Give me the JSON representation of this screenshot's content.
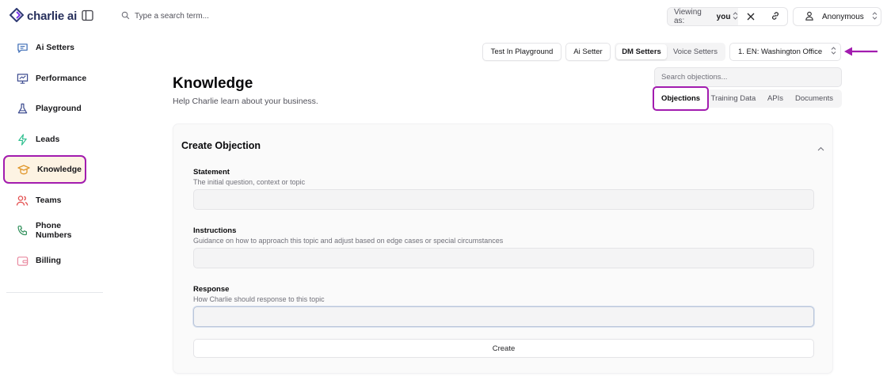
{
  "app": {
    "logo_text": "charlie ai",
    "brand_color": "#2f3a73",
    "accent_color": "#6d28d9",
    "annotation_color": "#a21caf"
  },
  "sidebar": {
    "items": [
      {
        "label": "Ai Setters",
        "icon": "chat-icon"
      },
      {
        "label": "Performance",
        "icon": "presentation-chart-icon"
      },
      {
        "label": "Playground",
        "icon": "flask-icon"
      },
      {
        "label": "Leads",
        "icon": "lightning-icon"
      },
      {
        "label": "Knowledge",
        "icon": "graduation-cap-icon",
        "active": true
      },
      {
        "label": "Teams",
        "icon": "users-icon"
      },
      {
        "label": "Phone Numbers",
        "icon": "phone-icon"
      },
      {
        "label": "Billing",
        "icon": "wallet-icon"
      }
    ]
  },
  "topbar": {
    "search_placeholder": "Type a search term...",
    "viewing_label": "Viewing as:",
    "viewing_value": "you",
    "user_name": "Anonymous"
  },
  "toolbar": {
    "test_playground": "Test In Playground",
    "ai_setter": "Ai Setter",
    "dm_setters": "DM Setters",
    "voice_setters": "Voice Setters",
    "office_select": "1. EN: Washington Office"
  },
  "page": {
    "title": "Knowledge",
    "subtitle": "Help Charlie learn about your business.",
    "search_placeholder": "Search objections...",
    "tabs": [
      "Objections",
      "Training Data",
      "APIs",
      "Documents"
    ],
    "active_tab": "Objections"
  },
  "form": {
    "title": "Create Objection",
    "fields": [
      {
        "label": "Statement",
        "description": "The initial question, context or topic",
        "value": ""
      },
      {
        "label": "Instructions",
        "description": "Guidance on how to approach this topic and adjust based on edge cases or special circumstances",
        "value": ""
      },
      {
        "label": "Response",
        "description": "How Charlie should response to this topic",
        "value": ""
      }
    ],
    "submit_label": "Create"
  }
}
